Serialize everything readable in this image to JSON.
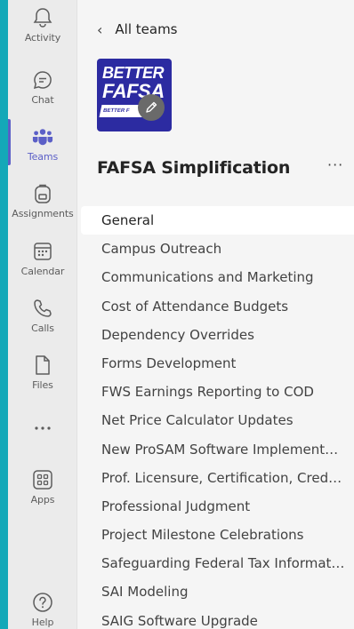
{
  "rail": {
    "items": [
      {
        "label": "Activity",
        "icon": "bell-icon"
      },
      {
        "label": "Chat",
        "icon": "chat-icon"
      },
      {
        "label": "Teams",
        "icon": "teams-icon",
        "active": true
      },
      {
        "label": "Assignments",
        "icon": "backpack-icon"
      },
      {
        "label": "Calendar",
        "icon": "calendar-icon"
      },
      {
        "label": "Calls",
        "icon": "phone-icon"
      },
      {
        "label": "Files",
        "icon": "file-icon"
      },
      {
        "label": "",
        "icon": "more-icon"
      },
      {
        "label": "Apps",
        "icon": "apps-icon"
      },
      {
        "label": "Help",
        "icon": "help-icon"
      }
    ]
  },
  "nav": {
    "back_label": "All teams"
  },
  "team": {
    "name": "FAFSA Simplification",
    "logo_line1": "BETTER",
    "logo_line2": "FAFSA",
    "logo_ribbon": "BETTER F",
    "more_glyph": "···"
  },
  "channels": [
    "General",
    "Campus Outreach",
    "Communications and Marketing",
    "Cost of Attendance Budgets",
    "Dependency Overrides",
    "Forms Development",
    "FWS Earnings Reporting to COD",
    "Net Price Calculator Updates",
    "New ProSAM Software Implementation",
    "Prof. Licensure, Certification, Credentials",
    "Professional Judgment",
    "Project Milestone Celebrations",
    "Safeguarding Federal Tax Information",
    "SAI Modeling",
    "SAIG Software Upgrade"
  ],
  "colors": {
    "accent": "#5b5fc7",
    "frame": "#13a8b8",
    "logo_bg": "#2c2ba1"
  }
}
